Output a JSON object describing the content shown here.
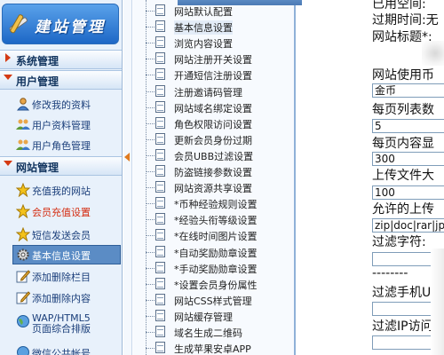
{
  "sidebar": {
    "logo_text": "建站管理",
    "sections": [
      {
        "label": "系统管理"
      },
      {
        "label": "用户管理"
      },
      {
        "label": "网站管理"
      }
    ],
    "user_items": [
      {
        "label": "修改我的资料",
        "icon": "person-icon"
      },
      {
        "label": "用户资料管理",
        "icon": "users-icon"
      },
      {
        "label": "用户角色管理",
        "icon": "users-icon"
      }
    ],
    "site_items": [
      {
        "label": "充值我的网站",
        "icon": "star-icon"
      },
      {
        "label": "会员充值设置",
        "icon": "star-icon"
      },
      {
        "label": "短信发送会员",
        "icon": "star-icon"
      },
      {
        "label": "基本信息设置",
        "icon": "gear-icon"
      },
      {
        "label": "添加删除栏目",
        "icon": "edit-icon"
      },
      {
        "label": "添加删除内容",
        "icon": "edit-icon"
      },
      {
        "label_line1": "WAP/HTML5",
        "label_line2": "页面综合排版",
        "icon": "globe-icon"
      },
      {
        "label": "微信公共帐号",
        "icon": "globe-icon"
      }
    ]
  },
  "tree": {
    "items": [
      {
        "label": "网站默认配置"
      },
      {
        "label": "基本信息设置"
      },
      {
        "label": "浏览内容设置"
      },
      {
        "label": "网站注册开关设置"
      },
      {
        "label": "开通短信注册设置"
      },
      {
        "label": "注册邀请码管理"
      },
      {
        "label": "网站域名绑定设置"
      },
      {
        "label": "角色权限访问设置"
      },
      {
        "label": "更新会员身份过期"
      },
      {
        "label": "会员UBB过滤设置"
      },
      {
        "label": "防盗链接参数设置"
      },
      {
        "label": "网站资源共享设置"
      },
      {
        "label": "*币种经验规则设置"
      },
      {
        "label": "*经验头衔等级设置"
      },
      {
        "label": "*在线时间图片设置"
      },
      {
        "label": "*自动奖励勋章设置"
      },
      {
        "label": "*手动奖励勋章设置"
      },
      {
        "label": "*设置会员身份属性"
      },
      {
        "label": "网站CSS样式管理"
      },
      {
        "label": "网站缓存管理"
      },
      {
        "label": "域名生成二维码"
      },
      {
        "label": "生成苹果安卓APP"
      }
    ]
  },
  "form": {
    "used_space": "已用空间:",
    "expire_time": "过期时间:无",
    "site_title": "网站标题*:",
    "currency_label": "网站使用币",
    "currency_value": "金币",
    "list_per_page_label": "每页列表数",
    "list_per_page_value": "5",
    "content_per_page_label": "每页内容显",
    "content_per_page_value": "300",
    "upload_size_label": "上传文件大",
    "upload_size_value": "100",
    "allowed_upload_label": "允许的上传",
    "allowed_upload_value": "zip|doc|rar|jpg",
    "filter_chars_label": "过滤字符:",
    "divider_text": "--------",
    "filter_phone_label": "过滤手机UA",
    "filter_ip_label": "过滤IP访问"
  }
}
